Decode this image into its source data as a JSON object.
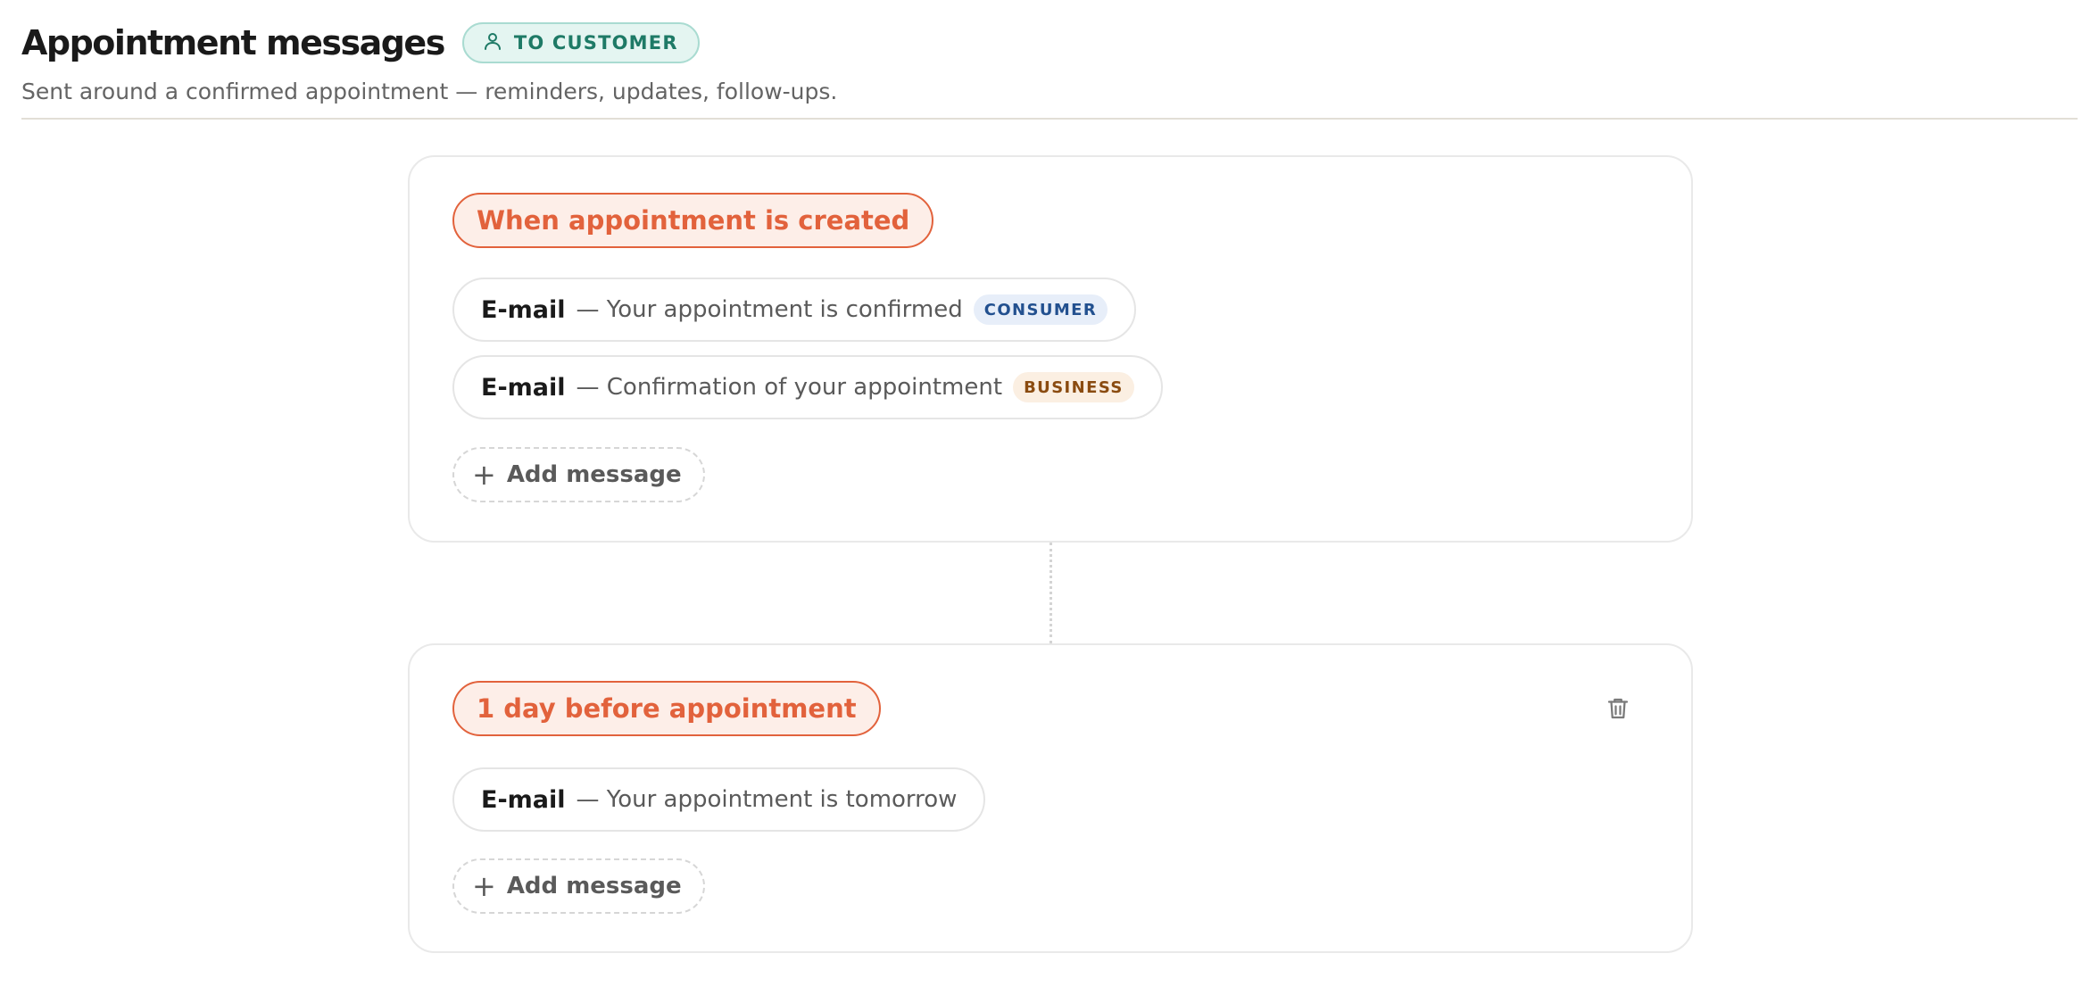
{
  "header": {
    "title": "Appointment messages",
    "audience_badge": "TO CUSTOMER",
    "audience_icon": "user-icon",
    "subtitle": "Sent around a confirmed appointment — reminders, updates, follow-ups."
  },
  "colors": {
    "accent": "#e2623c",
    "accent_bg": "#fdeee8",
    "badge_teal": "#1e7a66",
    "consumer_tag": "#22508f",
    "business_tag": "#8a4b10"
  },
  "triggers": [
    {
      "label": "When appointment is created",
      "messages": [
        {
          "channel": "E-mail",
          "text": "— Your appointment is confirmed",
          "tag": "CONSUMER"
        },
        {
          "channel": "E-mail",
          "text": "— Confirmation of your appointment",
          "tag": "BUSINESS"
        }
      ],
      "add_label": "Add message"
    },
    {
      "label": "1 day before appointment",
      "delete_icon": "trash-icon",
      "messages": [
        {
          "channel": "E-mail",
          "text": "— Your appointment is tomorrow"
        }
      ],
      "add_label": "Add message"
    }
  ]
}
